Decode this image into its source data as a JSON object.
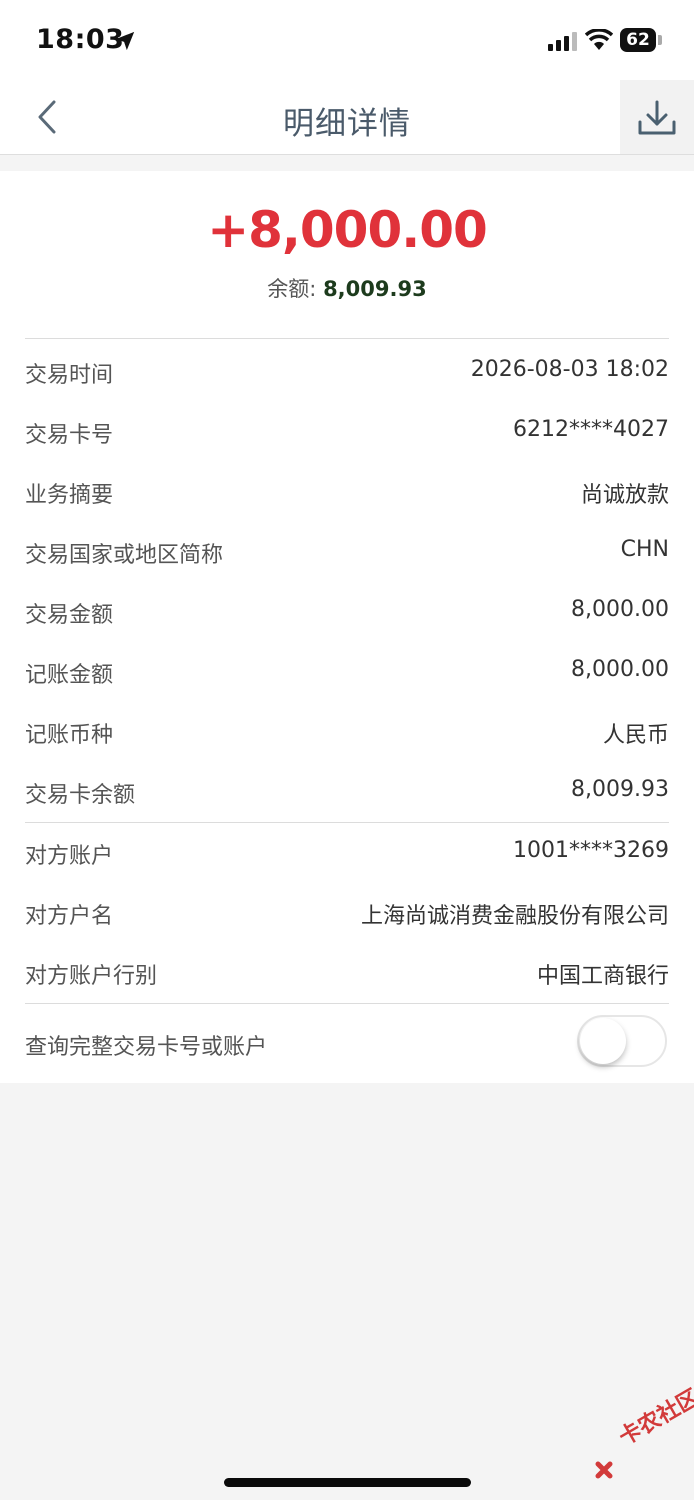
{
  "status_bar": {
    "time": "18:03",
    "battery": "62"
  },
  "nav": {
    "title": "明细详情"
  },
  "summary": {
    "amount": "+8,000.00",
    "balance_label": "余额:",
    "balance_value": "8,009.93"
  },
  "details": [
    {
      "label": "交易时间",
      "value": "2026-08-03 18:02"
    },
    {
      "label": "交易卡号",
      "value": "6212****4027"
    },
    {
      "label": "业务摘要",
      "value": "尚诚放款"
    },
    {
      "label": "交易国家或地区简称",
      "value": "CHN"
    },
    {
      "label": "交易金额",
      "value": "8,000.00"
    },
    {
      "label": "记账金额",
      "value": "8,000.00"
    },
    {
      "label": "记账币种",
      "value": "人民币"
    },
    {
      "label": "交易卡余额",
      "value": "8,009.93"
    }
  ],
  "counterparty": [
    {
      "label": "对方账户",
      "value": "1001****3269"
    },
    {
      "label": "对方户名",
      "value": "上海尚诚消费金融股份有限公司"
    },
    {
      "label": "对方账户行别",
      "value": "中国工商银行"
    }
  ],
  "toggle_row": {
    "label": "查询完整交易卡号或账户",
    "state": "off"
  },
  "watermark": {
    "text": "卡农社区"
  },
  "colors": {
    "amount": "#e0323a",
    "title": "#4a5a6a",
    "balance": "#1d3b1d"
  }
}
